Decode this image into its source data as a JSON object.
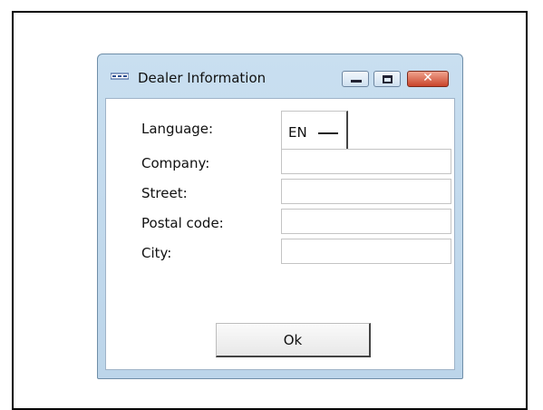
{
  "window": {
    "title": "Dealer Information",
    "caption_buttons": {
      "close_symbol": "✕"
    }
  },
  "form": {
    "language_label": "Language:",
    "language_value": "EN",
    "company_label": "Company:",
    "company_value": "",
    "street_label": "Street:",
    "street_value": "",
    "postal_label": "Postal code:",
    "postal_value": "",
    "city_label": "City:",
    "city_value": ""
  },
  "actions": {
    "ok_label": "Ok"
  },
  "icons": {
    "app": "app-icon",
    "minimize": "minimize-icon",
    "maximize": "maximize-icon",
    "close": "close-icon"
  },
  "colors": {
    "window_frame": "#bcd5ea",
    "close_button": "#c9442a"
  }
}
